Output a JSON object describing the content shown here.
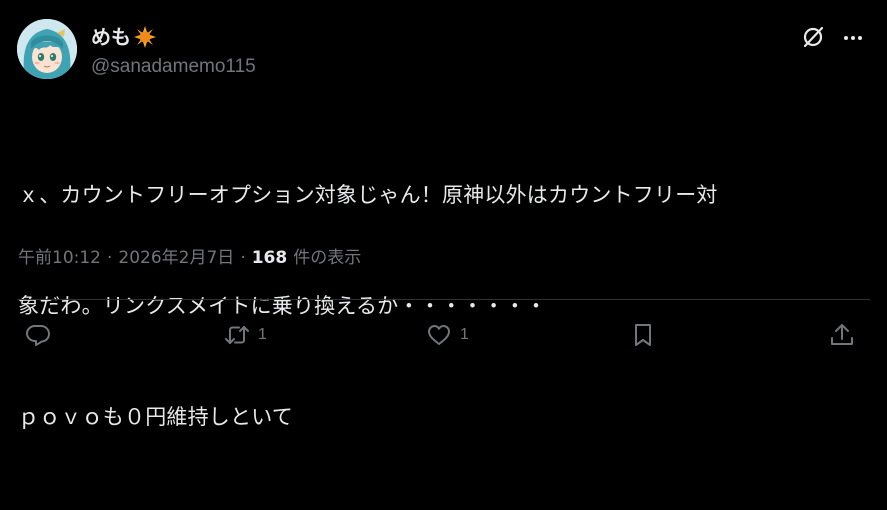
{
  "author": {
    "display_name": "めも",
    "name_emoji_icon": "sun-icon",
    "handle": "@sanadamemo115"
  },
  "tweet": {
    "lines": [
      "ｘ、カウントフリーオプション対象じゃん！原神以外はカウントフリー対",
      "象だわ。リンクスメイトに乗り換えるか・・・・・・・",
      "ｐｏｖｏも０円維持しといて"
    ]
  },
  "meta": {
    "time": "午前10:12",
    "separator": "·",
    "date": "2026年2月7日",
    "view_count": "168",
    "view_label": "件の表示"
  },
  "actions": {
    "reply_count": "",
    "retweet_count": "1",
    "like_count": "1"
  },
  "colors": {
    "background": "#000000",
    "text": "#e7e9ea",
    "secondary": "#71767b",
    "divider": "#2f3336"
  }
}
